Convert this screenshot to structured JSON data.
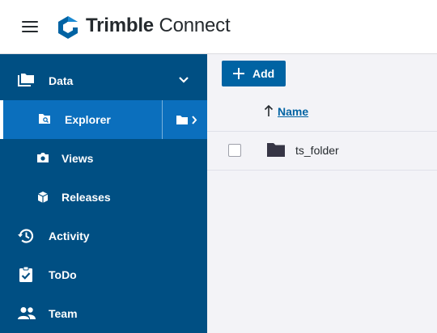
{
  "header": {
    "brand_bold": "Trimble",
    "brand_light": "Connect",
    "menu_icon": "hamburger-menu-icon",
    "logo_icon": "trimble-logo-icon"
  },
  "colors": {
    "sidebar": "#004f83",
    "sidebar_active": "#0b6fbd",
    "primary_button": "#0063a3",
    "content_bg": "#f3f3f7"
  },
  "sidebar": {
    "items": [
      {
        "label": "Data",
        "icon": "folder-stack-icon",
        "expanded": true
      },
      {
        "label": "Explorer",
        "icon": "folder-search-icon",
        "active": true,
        "trailing_icon": "folder-chevron-icon"
      },
      {
        "label": "Views",
        "icon": "camera-icon"
      },
      {
        "label": "Releases",
        "icon": "package-icon"
      },
      {
        "label": "Activity",
        "icon": "history-icon"
      },
      {
        "label": "ToDo",
        "icon": "clipboard-check-icon"
      },
      {
        "label": "Team",
        "icon": "people-icon"
      }
    ]
  },
  "toolbar": {
    "add_label": "Add"
  },
  "table": {
    "columns": [
      {
        "label": "Name",
        "sort": "ascending"
      }
    ],
    "rows": [
      {
        "name": "ts_folder",
        "type": "folder",
        "checked": false
      }
    ]
  }
}
